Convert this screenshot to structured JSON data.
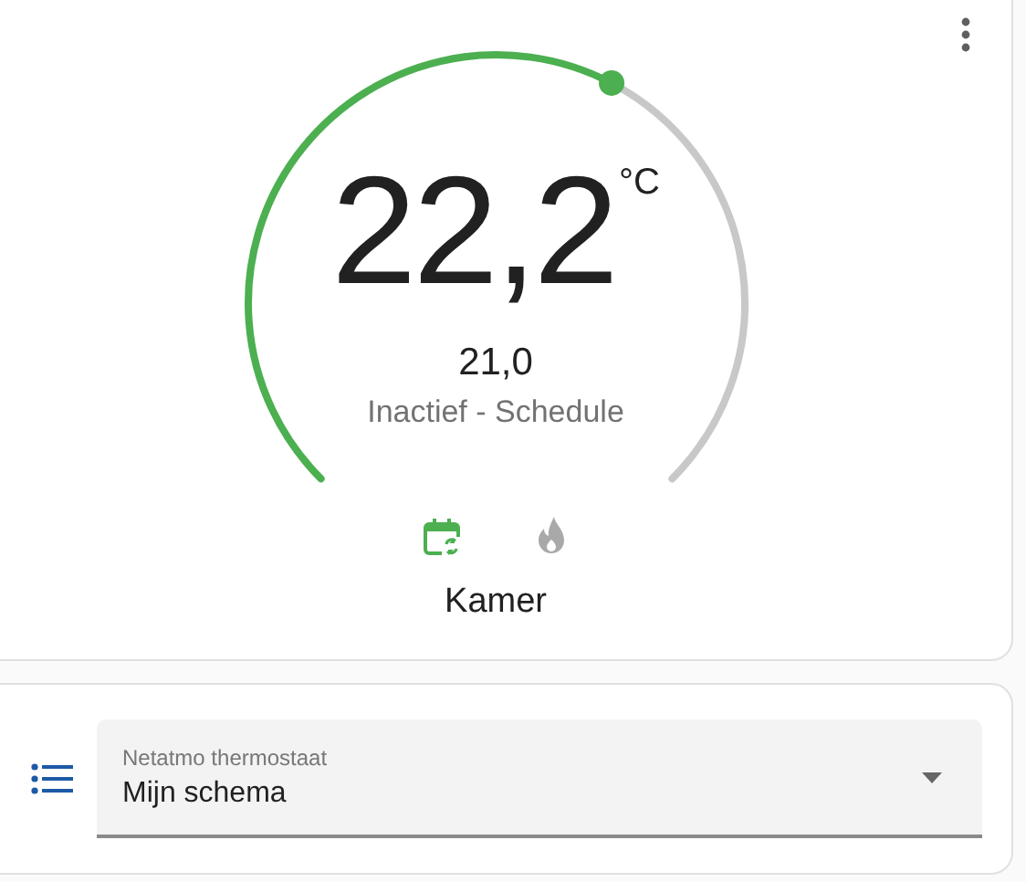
{
  "thermostat": {
    "current_temperature": "22,2",
    "unit": "°C",
    "target_temperature": "21,0",
    "status": "Inactief - Schedule",
    "modes": [
      {
        "kind": "schedule",
        "selected": true
      },
      {
        "kind": "heat",
        "selected": false
      }
    ],
    "name": "Kamer"
  },
  "schedule_select": {
    "label": "Netatmo thermostaat",
    "value": "Mijn schema"
  }
}
